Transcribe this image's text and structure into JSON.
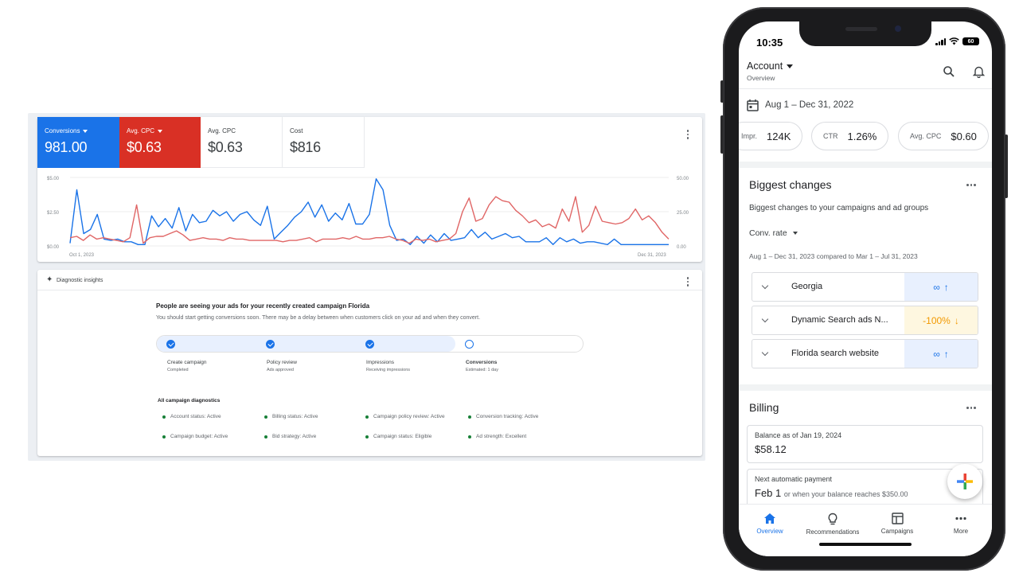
{
  "desktop": {
    "metrics": [
      {
        "label": "Conversions",
        "value": "981.00",
        "dropdown": true,
        "color": "#1a73e8"
      },
      {
        "label": "Avg. CPC",
        "value": "$0.63",
        "dropdown": true,
        "color": "#d93025"
      },
      {
        "label": "Avg. CPC",
        "value": "$0.63",
        "dropdown": false
      },
      {
        "label": "Cost",
        "value": "$816",
        "dropdown": false
      }
    ],
    "chart_data": {
      "type": "line",
      "x_start": "Oct 1, 2023",
      "x_end": "Dec 31, 2023",
      "left_axis_ticks": [
        "$5.00",
        "$2.50",
        "$0.00"
      ],
      "right_axis_ticks": [
        "50.00",
        "25.00",
        "0.00"
      ],
      "left_ylim": [
        0,
        5
      ],
      "right_ylim": [
        0,
        50
      ],
      "series": [
        {
          "color": "#1a73e8",
          "axis": "left",
          "values": [
            0.2,
            4.1,
            0.9,
            1.2,
            2.3,
            0.5,
            0.4,
            0.5,
            0.3,
            0.3,
            0.1,
            0.1,
            2.2,
            1.4,
            2.0,
            1.3,
            2.8,
            1.1,
            2.3,
            1.7,
            1.8,
            2.6,
            2.2,
            2.5,
            1.8,
            2.3,
            2.5,
            1.9,
            1.5,
            2.9,
            0.5,
            1.0,
            1.5,
            2.1,
            2.5,
            3.2,
            2.1,
            3.0,
            1.8,
            2.4,
            1.9,
            3.1,
            1.6,
            1.6,
            2.3,
            4.9,
            4.1,
            1.5,
            0.4,
            0.5,
            0.1,
            0.7,
            0.2,
            0.8,
            0.3,
            0.9,
            0.4,
            0.5,
            0.6,
            1.2,
            0.6,
            1.0,
            0.5,
            0.7,
            0.9,
            0.6,
            0.7,
            0.3,
            0.3,
            0.3,
            0.6,
            0.1,
            0.6,
            0.3,
            0.5,
            0.2,
            0.3,
            0.3,
            0.2,
            0.1,
            0.5,
            0.1,
            0.1,
            0.1,
            0.1,
            0.1,
            0.1,
            0.1,
            0.1
          ]
        },
        {
          "color": "#e06666",
          "axis": "right",
          "values": [
            6,
            7,
            4,
            8,
            5,
            6,
            5,
            4,
            3,
            6,
            30,
            2,
            6,
            7,
            7,
            9,
            11,
            8,
            4,
            5,
            6,
            5,
            5,
            4,
            6,
            5,
            5,
            4,
            4,
            4,
            4,
            4,
            3,
            4,
            4,
            5,
            6,
            3,
            5,
            5,
            5,
            6,
            5,
            7,
            5,
            5,
            6,
            6,
            7,
            5,
            4,
            2,
            5,
            4,
            5,
            3,
            4,
            5,
            9,
            25,
            35,
            18,
            20,
            30,
            36,
            33,
            32,
            26,
            22,
            17,
            19,
            14,
            16,
            13,
            27,
            18,
            36,
            10,
            15,
            29,
            18,
            17,
            16,
            17,
            20,
            27,
            19,
            22,
            17,
            10,
            5
          ]
        }
      ]
    },
    "insights": {
      "title": "Diagnostic insights",
      "heading": "People are seeing your ads for your recently created campaign Florida",
      "subheading": "You should start getting conversions soon. There may be a delay between when customers click on your ad and when they convert.",
      "progress_fraction": 0.7,
      "steps": [
        {
          "title": "Create campaign",
          "status": "Completed",
          "state": "done"
        },
        {
          "title": "Policy review",
          "status": "Ads approved",
          "state": "done"
        },
        {
          "title": "Impressions",
          "status": "Receiving impressions",
          "state": "done"
        },
        {
          "title": "Conversions",
          "status": "Estimated: 1 day",
          "state": "pending"
        }
      ],
      "diagnostics_heading": "All campaign diagnostics",
      "diagnostics": [
        "Account status: Active",
        "Billing status: Active",
        "Campaign policy review: Active",
        "Conversion tracking: Active",
        "Campaign budget: Active",
        "Bid strategy: Active",
        "Campaign status: Eligible",
        "Ad strength: Excellent"
      ],
      "status_color": "#188038"
    }
  },
  "phone": {
    "time": "10:35",
    "battery": "60",
    "account": {
      "title": "Account",
      "subtitle": "Overview"
    },
    "date_range": "Aug 1 – Dec 31, 2022",
    "stats": [
      {
        "label": "Impr.",
        "value": "124K"
      },
      {
        "label": "CTR",
        "value": "1.26%"
      },
      {
        "label": "Avg. CPC",
        "value": "$0.60"
      }
    ],
    "biggest_changes": {
      "title": "Biggest changes",
      "description": "Biggest changes to your campaigns and ad groups",
      "metric": "Conv. rate",
      "comparison": "Aug 1 – Dec 31, 2023 compared to Mar 1 – Jul 31, 2023",
      "rows": [
        {
          "name": "Georgia",
          "value": "∞",
          "arrow": "↑",
          "direction": "up"
        },
        {
          "name": "Dynamic Search ads N...",
          "value": "-100%",
          "arrow": "↓",
          "direction": "down"
        },
        {
          "name": "Florida search website",
          "value": "∞",
          "arrow": "↑",
          "direction": "up"
        }
      ]
    },
    "billing": {
      "title": "Billing",
      "balance_label": "Balance as of Jan 19, 2024",
      "balance_value": "$58.12",
      "next_label": "Next automatic payment",
      "next_value": "Feb 1",
      "next_note": "or when your balance reaches $350.00"
    },
    "nav": [
      {
        "label": "Overview",
        "icon": "home-icon",
        "active": true
      },
      {
        "label": "Recommendations",
        "icon": "lightbulb-icon",
        "active": false
      },
      {
        "label": "Campaigns",
        "icon": "campaigns-icon",
        "active": false
      },
      {
        "label": "More",
        "icon": "more-icon",
        "active": false
      }
    ],
    "accent_color": "#1a73e8"
  }
}
